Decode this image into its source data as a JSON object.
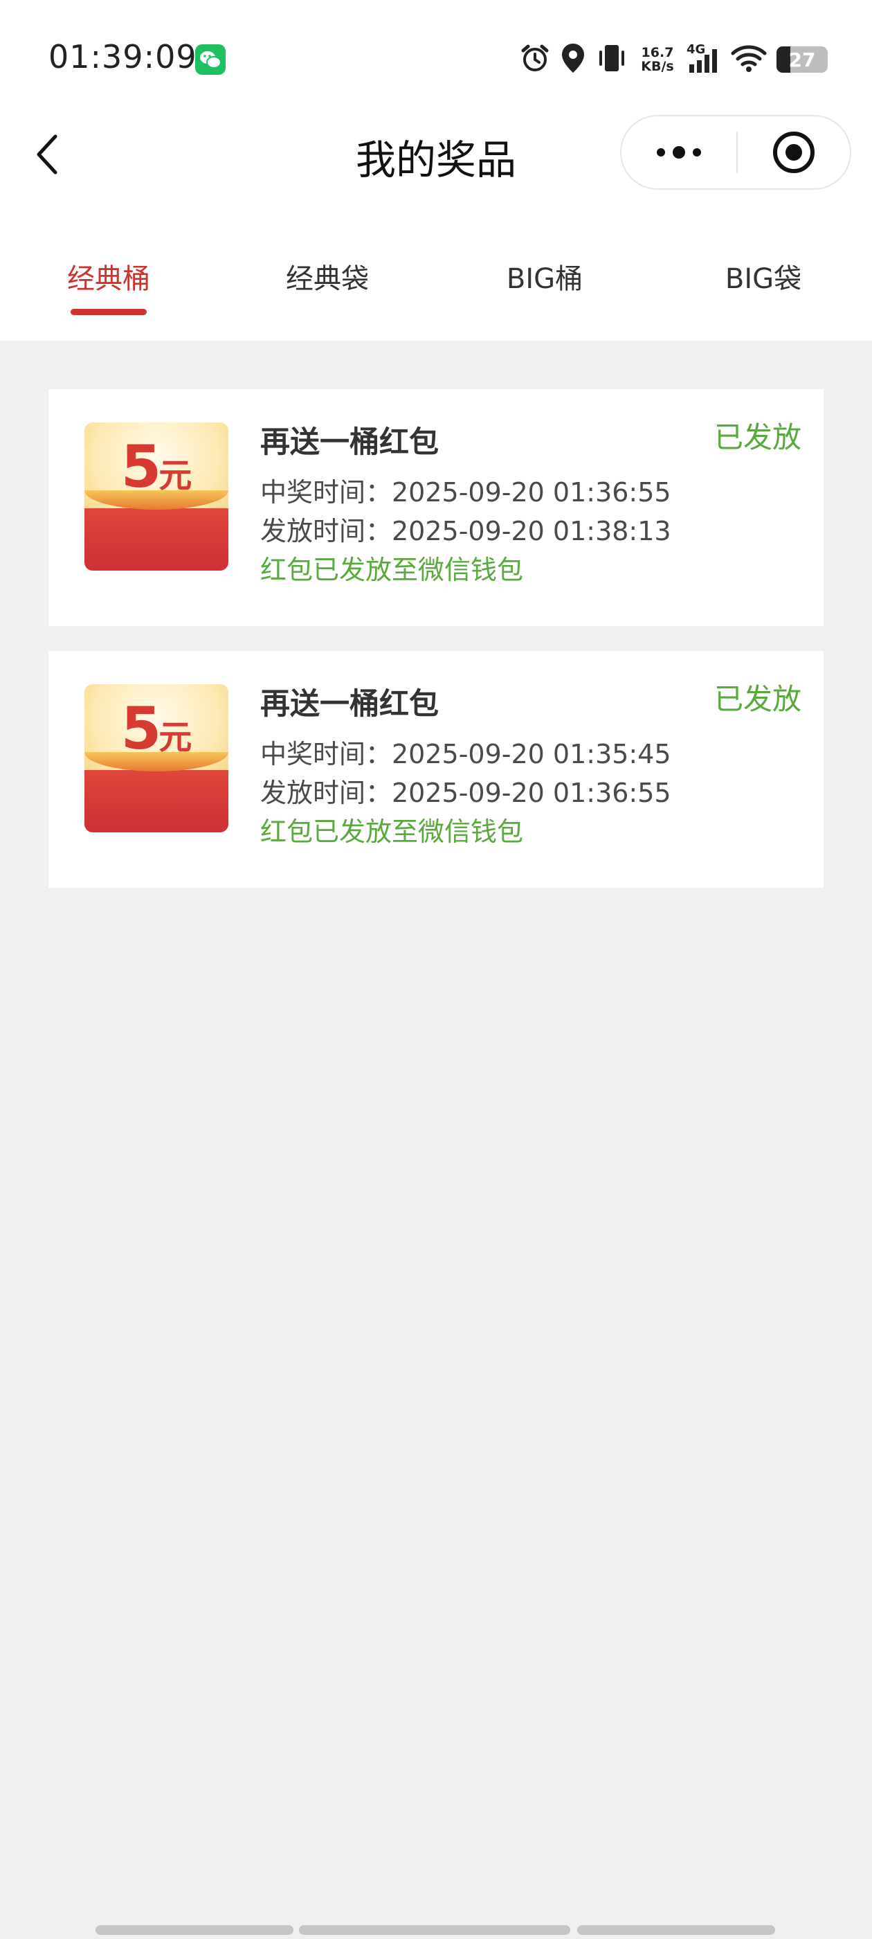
{
  "status_bar": {
    "time": "01:39:09",
    "net_speed_value": "16.7",
    "net_speed_unit": "KB/s",
    "network_type": "4G",
    "battery_level": "27",
    "icons": [
      "wechat-icon",
      "alarm-icon",
      "location-icon",
      "vibrate-icon",
      "signal-icon",
      "wifi-icon",
      "battery-icon"
    ]
  },
  "nav": {
    "title": "我的奖品"
  },
  "tabs": [
    {
      "label": "经典桶",
      "active": true
    },
    {
      "label": "经典袋",
      "active": false
    },
    {
      "label": "BIG桶",
      "active": false
    },
    {
      "label": "BIG袋",
      "active": false
    }
  ],
  "prizes": [
    {
      "amount": "5",
      "unit": "元",
      "title": "再送一桶红包",
      "status": "已发放",
      "win_time": "中奖时间：2025-09-20 01:36:55",
      "issue_time": "发放时间：2025-09-20 01:38:13",
      "note": "红包已发放至微信钱包"
    },
    {
      "amount": "5",
      "unit": "元",
      "title": "再送一桶红包",
      "status": "已发放",
      "win_time": "中奖时间：2025-09-20 01:35:45",
      "issue_time": "发放时间：2025-09-20 01:36:55",
      "note": "红包已发放至微信钱包"
    }
  ],
  "colors": {
    "accent_red": "#c9342e",
    "status_green": "#5aa93e",
    "page_bg": "#f0f0f0",
    "card_bg": "#ffffff"
  }
}
